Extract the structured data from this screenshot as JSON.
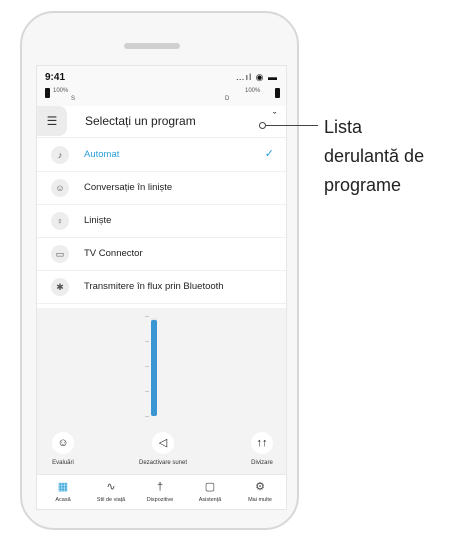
{
  "status_bar": {
    "time": "9:41",
    "system_icons": "…ıl ◉ ▬",
    "left_battery": "100%",
    "left_side": "S",
    "right_battery": "100%",
    "right_side": "D"
  },
  "header": {
    "title": "Selectați un program",
    "menu_icon": "☰",
    "chevron_icon": "ˇ"
  },
  "programs": [
    {
      "label": "Automat",
      "icon": "ear-auto-icon",
      "glyph": "♪",
      "active": true
    },
    {
      "label": "Conversație în liniște",
      "icon": "conversation-icon",
      "glyph": "☺"
    },
    {
      "label": "Liniște",
      "icon": "person-calm-icon",
      "glyph": "♀"
    },
    {
      "label": "TV Connector",
      "icon": "tv-icon",
      "glyph": "▭"
    },
    {
      "label": "Transmitere în flux prin Bluetooth",
      "icon": "bluetooth-icon",
      "glyph": "✱"
    }
  ],
  "check_icon": "✓",
  "volume": {
    "level": 0.98
  },
  "actions": [
    {
      "label": "Evaluări",
      "glyph": "☺"
    },
    {
      "label": "Dezactivare sunet",
      "glyph": "◁"
    },
    {
      "label": "Divizare",
      "glyph": "↑↑"
    }
  ],
  "tabs": [
    {
      "label": "Acasă",
      "glyph": "▦",
      "active": true
    },
    {
      "label": "Stil de viață",
      "glyph": "∿"
    },
    {
      "label": "Dispozitive",
      "glyph": "†"
    },
    {
      "label": "Asistență",
      "glyph": "▢"
    },
    {
      "label": "Mai multe",
      "glyph": "⚙"
    }
  ],
  "callout": {
    "line1": "Lista",
    "line2": "derulantă de",
    "line3": "programe"
  }
}
